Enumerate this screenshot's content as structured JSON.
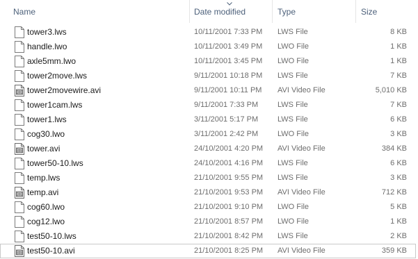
{
  "columns": {
    "name": "Name",
    "date": "Date modified",
    "type": "Type",
    "size": "Size"
  },
  "sort": {
    "column": "date",
    "icon": "chevron-down-icon"
  },
  "files": [
    {
      "name": "tower3.lws",
      "date": "10/11/2001 7:33 PM",
      "type": "LWS File",
      "size": "8 KB",
      "icon": "document-icon"
    },
    {
      "name": "handle.lwo",
      "date": "10/11/2001 3:49 PM",
      "type": "LWO File",
      "size": "1 KB",
      "icon": "document-icon"
    },
    {
      "name": "axle5mm.lwo",
      "date": "10/11/2001 3:45 PM",
      "type": "LWO File",
      "size": "1 KB",
      "icon": "document-icon"
    },
    {
      "name": "tower2move.lws",
      "date": "9/11/2001 10:18 PM",
      "type": "LWS File",
      "size": "7 KB",
      "icon": "document-icon"
    },
    {
      "name": "tower2movewire.avi",
      "date": "9/11/2001 10:11 PM",
      "type": "AVI Video File",
      "size": "5,010 KB",
      "icon": "video-file-icon"
    },
    {
      "name": "tower1cam.lws",
      "date": "9/11/2001 7:33 PM",
      "type": "LWS File",
      "size": "7 KB",
      "icon": "document-icon"
    },
    {
      "name": "tower1.lws",
      "date": "3/11/2001 5:17 PM",
      "type": "LWS File",
      "size": "6 KB",
      "icon": "document-icon"
    },
    {
      "name": "cog30.lwo",
      "date": "3/11/2001 2:42 PM",
      "type": "LWO File",
      "size": "3 KB",
      "icon": "document-icon"
    },
    {
      "name": "tower.avi",
      "date": "24/10/2001 4:20 PM",
      "type": "AVI Video File",
      "size": "384 KB",
      "icon": "video-file-icon"
    },
    {
      "name": "tower50-10.lws",
      "date": "24/10/2001 4:16 PM",
      "type": "LWS File",
      "size": "6 KB",
      "icon": "document-icon"
    },
    {
      "name": "temp.lws",
      "date": "21/10/2001 9:55 PM",
      "type": "LWS File",
      "size": "3 KB",
      "icon": "document-icon"
    },
    {
      "name": "temp.avi",
      "date": "21/10/2001 9:53 PM",
      "type": "AVI Video File",
      "size": "712 KB",
      "icon": "video-file-icon"
    },
    {
      "name": "cog60.lwo",
      "date": "21/10/2001 9:10 PM",
      "type": "LWO File",
      "size": "5 KB",
      "icon": "document-icon"
    },
    {
      "name": "cog12.lwo",
      "date": "21/10/2001 8:57 PM",
      "type": "LWO File",
      "size": "1 KB",
      "icon": "document-icon"
    },
    {
      "name": "test50-10.lws",
      "date": "21/10/2001 8:42 PM",
      "type": "LWS File",
      "size": "2 KB",
      "icon": "document-icon"
    },
    {
      "name": "test50-10.avi",
      "date": "21/10/2001 8:25 PM",
      "type": "AVI Video File",
      "size": "359 KB",
      "icon": "video-file-icon",
      "selected": true
    }
  ]
}
